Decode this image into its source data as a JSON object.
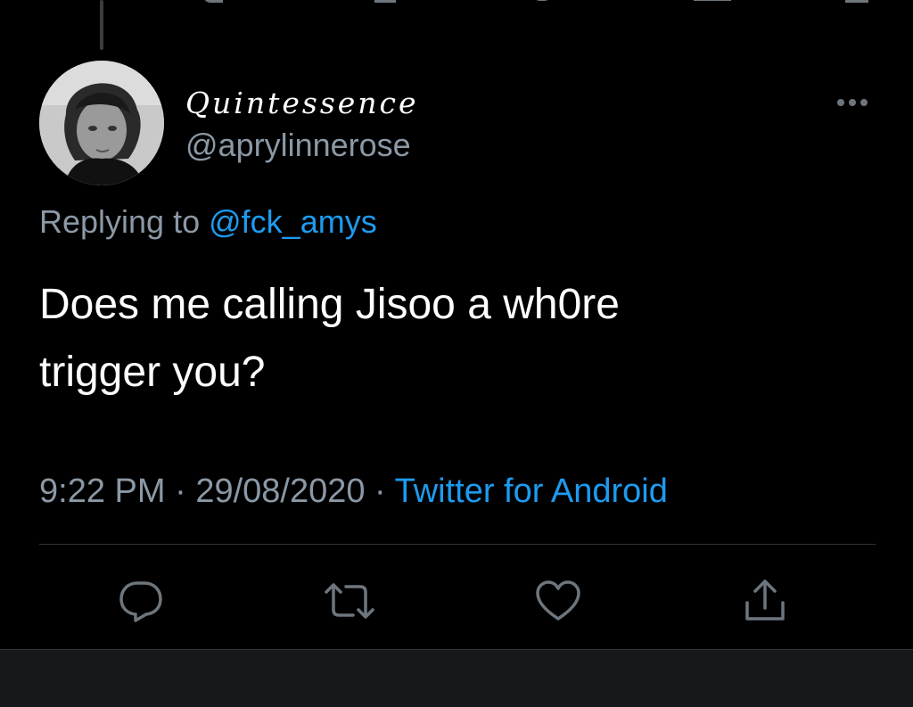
{
  "tweet": {
    "display_name": "Quintessence",
    "handle": "@aprylinnerose",
    "replying_prefix": "Replying to",
    "replying_to": "@fck_amys",
    "text_line1": "Does me calling Jisoo a wh0re",
    "text_line2": "trigger you?",
    "time": "9:22 PM",
    "separator": " · ",
    "date": "29/08/2020",
    "source": "Twitter for Android"
  },
  "actions": [
    {
      "icon": "reply-icon"
    },
    {
      "icon": "retweet-icon"
    },
    {
      "icon": "like-icon"
    },
    {
      "icon": "share-icon"
    }
  ],
  "colors": {
    "background": "#000000",
    "text_primary": "#ffffff",
    "text_secondary": "#8b98a5",
    "link": "#1d9bf0",
    "icon": "#6e767d"
  }
}
